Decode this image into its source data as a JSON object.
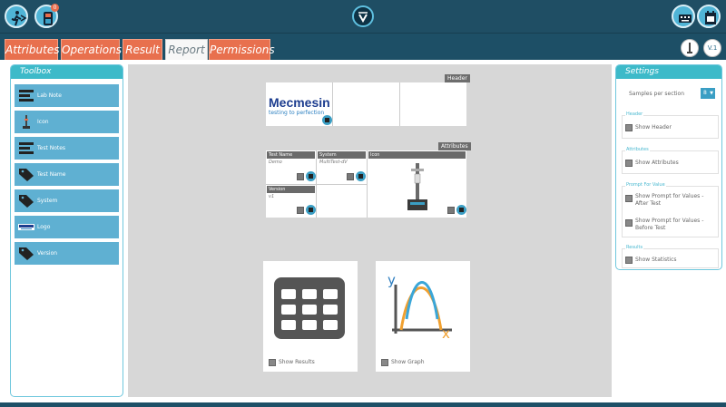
{
  "header": {
    "exit_icon": "exit-icon",
    "device_icon": "device-icon",
    "notification_count": "0",
    "brand_icon": "brand-v-icon",
    "keyboard_icon": "keyboard-icon",
    "calendar_icon": "calendar-icon"
  },
  "tabs": [
    {
      "label": "Attributes"
    },
    {
      "label": "Operations"
    },
    {
      "label": "Result"
    },
    {
      "label": "Report"
    },
    {
      "label": "Permissions"
    }
  ],
  "version_label": "V.1",
  "toolbox": {
    "title": "Toolbox",
    "items": [
      {
        "label": "Lab Note"
      },
      {
        "label": "Icon"
      },
      {
        "label": "Test Notes"
      },
      {
        "label": "Test Name"
      },
      {
        "label": "System"
      },
      {
        "label": "Logo"
      },
      {
        "label": "Version"
      }
    ]
  },
  "canvas": {
    "header_section_label": "Header",
    "logo_text_main": "Mecmesin",
    "logo_text_sub": "testing to perfection",
    "attributes_section_label": "Attributes",
    "attributes": [
      {
        "name": "Test Name",
        "value": "Demo"
      },
      {
        "name": "System",
        "value": "MultiTest-dV"
      },
      {
        "name": "Icon",
        "value": ""
      },
      {
        "name": "Version",
        "value": "v1"
      }
    ],
    "results_card_label": "Show Results",
    "graph_card_label": "Show Graph",
    "graph_axis_y": "y",
    "graph_axis_x": "x"
  },
  "settings": {
    "title": "Settings",
    "samples_label": "Samples per section",
    "samples_value": "8",
    "groups": [
      {
        "title": "Header",
        "options": [
          "Show Header"
        ]
      },
      {
        "title": "Attributes",
        "options": [
          "Show Attributes"
        ]
      },
      {
        "title": "Prompt For Value",
        "options": [
          "Show Prompt for Values - After Test",
          "Show Prompt for Values - Before Test"
        ]
      },
      {
        "title": "Results",
        "options": [
          "Show Statistics"
        ]
      }
    ]
  },
  "colors": {
    "accent": "#3dbac9",
    "tab": "#e8704e",
    "topbar": "#1f4e64"
  }
}
